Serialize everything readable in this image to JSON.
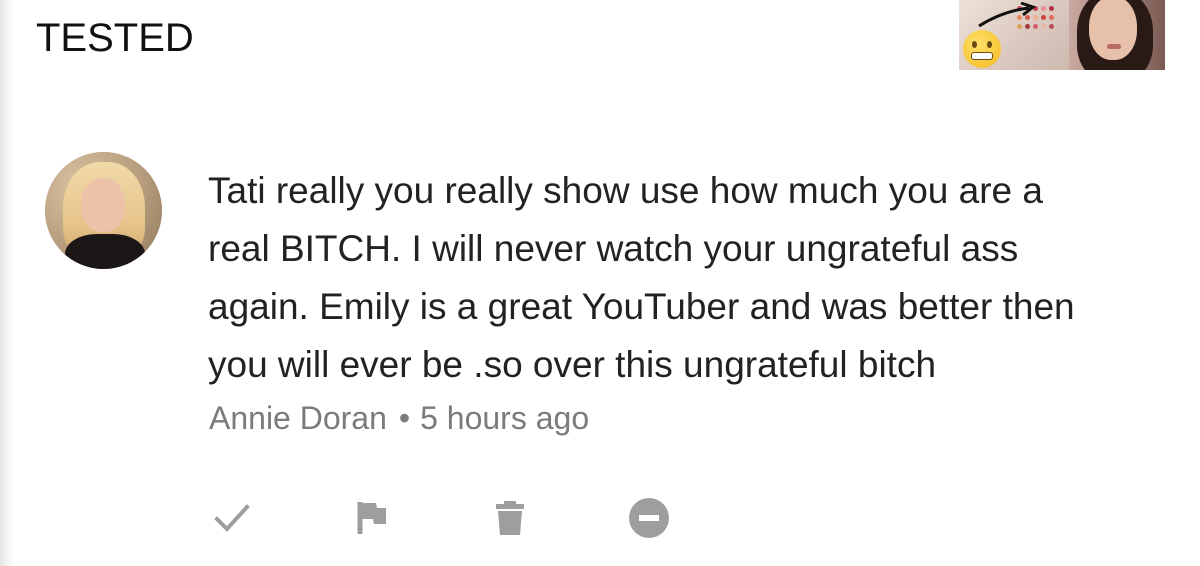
{
  "video": {
    "title": "TESTED",
    "thumbnail_icon": "video-thumbnail"
  },
  "comment": {
    "author": "Annie Doran",
    "separator": "•",
    "time": "5 hours ago",
    "lines": [
      "Tati really you really show use how much you are a",
      "real  BITCH. I will never watch your ungrateful ass",
      "again. Emily is a great YouTuber and was better then",
      "you will ever be .so over this ungrateful bitch"
    ]
  },
  "actions": {
    "approve_icon": "check-icon",
    "flag_icon": "flag-icon",
    "delete_icon": "trash-icon",
    "ban_icon": "minus-circle-icon"
  },
  "colors": {
    "text_primary": "#222222",
    "text_secondary": "#7b7b7b",
    "icon_gray": "#9e9e9e",
    "background": "#ffffff"
  }
}
